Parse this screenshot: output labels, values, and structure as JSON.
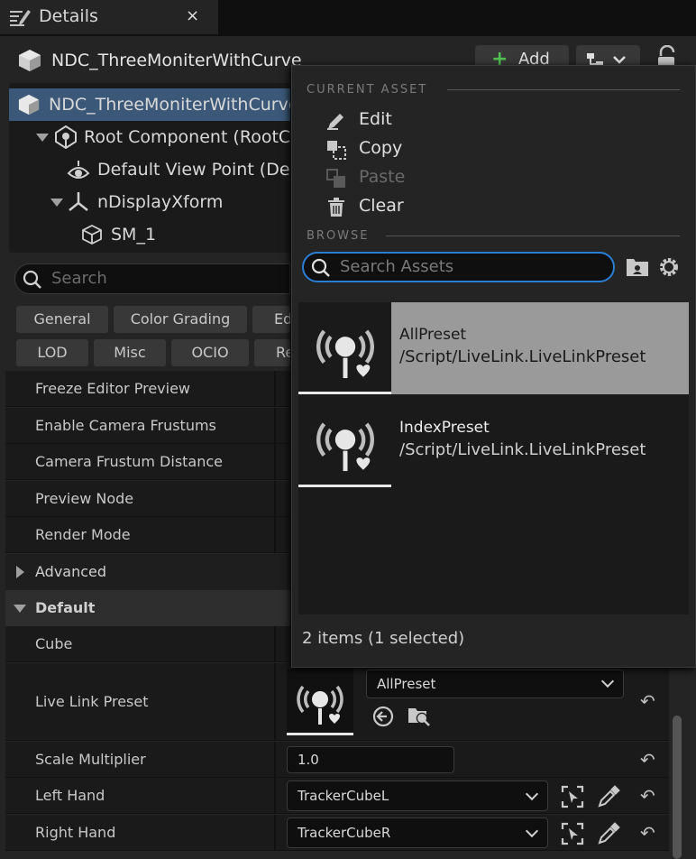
{
  "tab": {
    "title": "Details",
    "close": "×"
  },
  "actor": {
    "title": "NDC_ThreeMoniterWithCurve"
  },
  "toolbar": {
    "add_label": "Add"
  },
  "tree": [
    {
      "label": "NDC_ThreeMoniterWithCurve (",
      "icon": "actor-icon"
    },
    {
      "label": "Root Component (RootCom",
      "icon": "root-component-icon"
    },
    {
      "label": "Default View Point (Defa",
      "icon": "view-point-icon"
    },
    {
      "label": "nDisplayXform",
      "icon": "xform-icon"
    },
    {
      "label": "SM_1",
      "icon": "static-mesh-icon"
    }
  ],
  "search": {
    "placeholder": "Search"
  },
  "filters": {
    "row1": [
      "General",
      "Color Grading",
      "Ed"
    ],
    "row2": [
      "LOD",
      "Misc",
      "OCIO",
      "Re"
    ]
  },
  "properties": [
    "Freeze Editor Preview",
    "Enable Camera Frustums",
    "Camera Frustum Distance",
    "Preview Node",
    "Render Mode"
  ],
  "sections": {
    "advanced": "Advanced",
    "default": "Default"
  },
  "default_props": {
    "cube": "Cube",
    "live_link_preset": "Live Link Preset",
    "live_link_value": "AllPreset",
    "scale_multiplier": "Scale Multiplier",
    "scale_value": "1.0",
    "left_hand": "Left Hand",
    "left_hand_value": "TrackerCubeL",
    "right_hand": "Right Hand",
    "right_hand_value": "TrackerCubeR"
  },
  "popup": {
    "current_asset_header": "CURRENT ASSET",
    "edit": "Edit",
    "copy": "Copy",
    "paste": "Paste",
    "clear": "Clear",
    "browse_header": "BROWSE",
    "search_placeholder": "Search Assets",
    "assets": [
      {
        "name": "AllPreset",
        "path": "/Script/LiveLink.LiveLinkPreset",
        "selected": true
      },
      {
        "name": "IndexPreset",
        "path": "/Script/LiveLink.LiveLinkPreset",
        "selected": false
      }
    ],
    "count": "2 items (1 selected)"
  },
  "colors": {
    "accent_blue": "#2a7fd4",
    "selection": "#3c5878",
    "add_green": "#4fbf4f"
  }
}
